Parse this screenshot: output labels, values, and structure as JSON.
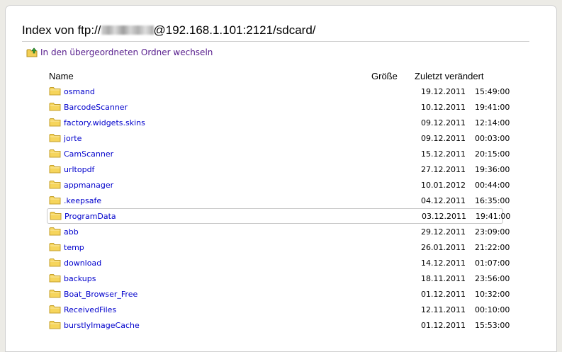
{
  "title": {
    "prefix": "Index von ftp://",
    "suffix": "@192.168.1.101:2121/sdcard/"
  },
  "parent_link": "In den übergeordneten Ordner wechseln",
  "columns": {
    "name": "Name",
    "size": "Größe",
    "modified": "Zuletzt verändert"
  },
  "icons": {
    "folder": "folder-icon",
    "parent": "folder-up-icon",
    "folder_color": "#f6d55c"
  },
  "rows": [
    {
      "name": "osmand",
      "date": "19.12.2011",
      "time": "15:49:00"
    },
    {
      "name": "BarcodeScanner",
      "date": "10.12.2011",
      "time": "19:41:00"
    },
    {
      "name": "factory.widgets.skins",
      "date": "09.12.2011",
      "time": "12:14:00"
    },
    {
      "name": "jorte",
      "date": "09.12.2011",
      "time": "00:03:00"
    },
    {
      "name": "CamScanner",
      "date": "15.12.2011",
      "time": "20:15:00"
    },
    {
      "name": "urltopdf",
      "date": "27.12.2011",
      "time": "19:36:00"
    },
    {
      "name": "appmanager",
      "date": "10.01.2012",
      "time": "00:44:00"
    },
    {
      "name": ".keepsafe",
      "date": "04.12.2011",
      "time": "16:35:00"
    },
    {
      "name": "ProgramData",
      "date": "03.12.2011",
      "time": "19:41:00",
      "selected": true
    },
    {
      "name": "abb",
      "date": "29.12.2011",
      "time": "23:09:00"
    },
    {
      "name": "temp",
      "date": "26.01.2011",
      "time": "21:22:00"
    },
    {
      "name": "download",
      "date": "14.12.2011",
      "time": "01:07:00"
    },
    {
      "name": "backups",
      "date": "18.11.2011",
      "time": "23:56:00"
    },
    {
      "name": "Boat_Browser_Free",
      "date": "01.12.2011",
      "time": "10:32:00"
    },
    {
      "name": "ReceivedFiles",
      "date": "12.11.2011",
      "time": "00:10:00"
    },
    {
      "name": "burstlyImageCache",
      "date": "01.12.2011",
      "time": "15:53:00"
    }
  ]
}
